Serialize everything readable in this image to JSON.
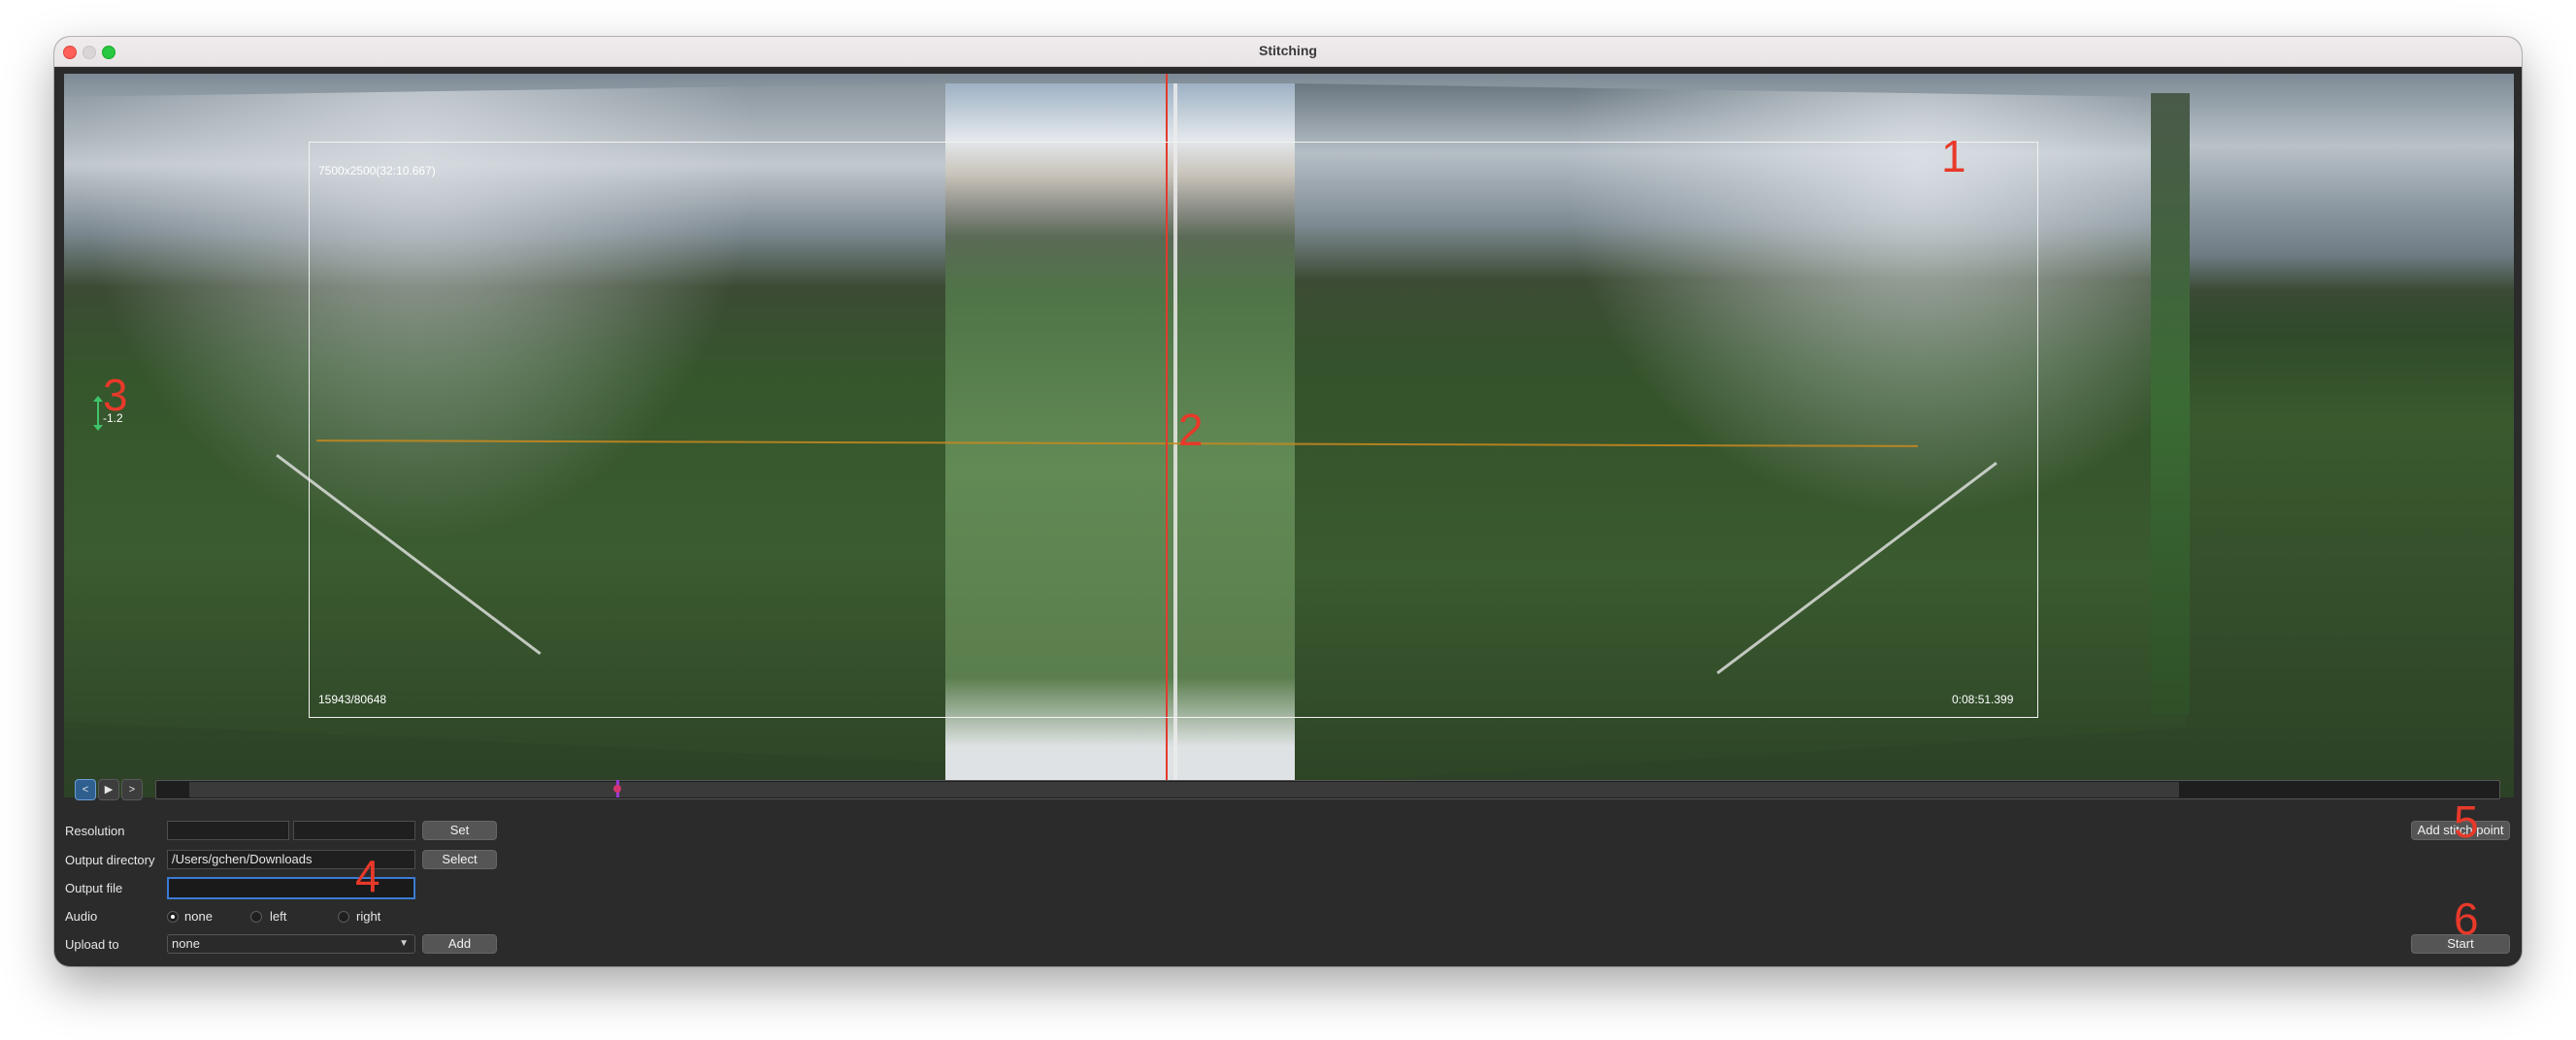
{
  "window": {
    "title": "Stitching"
  },
  "preview": {
    "resolution_overlay": "7500x2500(32:10.667)",
    "frame_counter": "15943/80648",
    "timestamp": "0:08:51.399",
    "tilt_value": "-1.2",
    "markers": [
      "1",
      "2",
      "3",
      "4",
      "5",
      "6"
    ]
  },
  "playback": {
    "prev_label": "<",
    "play_label": "▶",
    "next_label": ">",
    "position_fraction": 0.197
  },
  "form": {
    "resolution": {
      "label": "Resolution",
      "width_value": "",
      "height_value": "",
      "set_label": "Set"
    },
    "output_directory": {
      "label": "Output directory",
      "value": "/Users/gchen/Downloads",
      "select_label": "Select"
    },
    "output_file": {
      "label": "Output file",
      "value": ""
    },
    "audio": {
      "label": "Audio",
      "options": [
        "none",
        "left",
        "right"
      ],
      "selected": "none"
    },
    "upload_to": {
      "label": "Upload to",
      "selected": "none",
      "add_label": "Add"
    }
  },
  "actions": {
    "add_stitch_point_label": "Add stitch point",
    "start_label": "Start"
  },
  "colors": {
    "marker_red": "#e8392a",
    "focus_blue": "#3a7bd5",
    "playhead_purple": "#9b3bd6"
  }
}
